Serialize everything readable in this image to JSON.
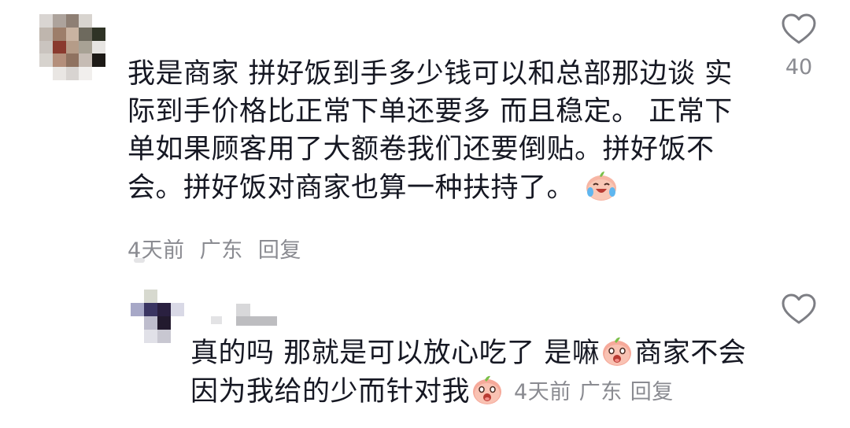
{
  "comment": {
    "lines": [
      "我是商家 拼好饭到手多少钱可以和总部那边谈 实",
      "际到手价格比正常下单还要多 而且稳定。 正常下",
      "单如果顾客用了大额卷我们还要倒贴。拼好饭不",
      "会。拼好饭对商家也算一种扶持了。"
    ],
    "emoji": "laughing-with-tears-emoji",
    "time": "4天前",
    "location": "广东",
    "reply_label": "回复",
    "like_icon": "heart-outline-icon",
    "like_count": "40"
  },
  "reply": {
    "line1_text": "真的吗 那就是可以放心吃了 是嘛",
    "line1_tail": "商家不会",
    "line2_text": "因为我给的少而针对我",
    "emoji": "peach-crying-emoji",
    "time": "4天前",
    "location": "广东",
    "reply_label": "回复",
    "like_icon": "heart-outline-icon"
  },
  "colors": {
    "text": "#161823",
    "meta": "#8a8b91",
    "icon": "#7d7e84"
  }
}
